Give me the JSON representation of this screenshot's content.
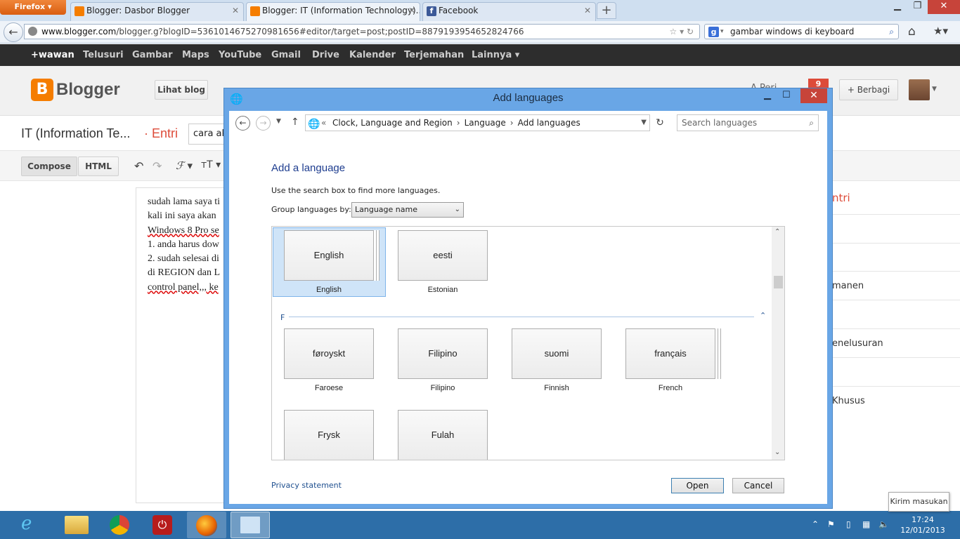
{
  "browser": {
    "firefox_label": "Firefox",
    "tabs": [
      {
        "title": "Blogger: Dasbor Blogger"
      },
      {
        "title": "Blogger: IT (Information Technology)..."
      },
      {
        "title": "Facebook"
      }
    ],
    "new_tab": "+",
    "url_host": "www.blogger.com",
    "url_path": "/blogger.g?blogID=5361014675270981656#editor/target=post;postID=8879193954652824766",
    "search_query": "gambar windows di keyboard"
  },
  "gbar": {
    "items": [
      "+wawan",
      "Telusuri",
      "Gambar",
      "Maps",
      "YouTube",
      "Gmail",
      "Drive",
      "Kalender",
      "Terjemahan",
      "Lainnya ▾"
    ]
  },
  "blogger": {
    "logo_text": "Blogger",
    "view_blog": "Lihat blog",
    "share": "Berbagi",
    "notif_count": "9",
    "post_blog": "IT (Information Te...",
    "post_entri": "· Entri",
    "title_value": "cara ak",
    "compose": "Compose",
    "html": "HTML",
    "editor_lines": [
      "sudah lama saya ti",
      "kali ini saya akan ",
      "Windows 8 Pro se",
      "1. anda harus dow",
      "2. sudah selesai di",
      "di REGION dan L",
      "control panel,,, ke"
    ],
    "side_items": [
      "ntri",
      "manen",
      "enelusuran",
      "Khusus"
    ],
    "partial_right": "A   Peri"
  },
  "dialog": {
    "title": "Add languages",
    "address": {
      "prefix": "«",
      "crumbs": [
        "Clock, Language and Region",
        "Language",
        "Add languages"
      ]
    },
    "search_placeholder": "Search languages",
    "heading": "Add a language",
    "hint": "Use the search box to find more languages.",
    "group_label": "Group languages by:",
    "group_value": "Language name",
    "section_f": "F",
    "languages": [
      {
        "native": "English",
        "name": "English"
      },
      {
        "native": "eesti",
        "name": "Estonian"
      },
      {
        "native": "føroyskt",
        "name": "Faroese"
      },
      {
        "native": "Filipino",
        "name": "Filipino"
      },
      {
        "native": "suomi",
        "name": "Finnish"
      },
      {
        "native": "français",
        "name": "French"
      },
      {
        "native": "Frysk",
        "name": ""
      },
      {
        "native": "Fulah",
        "name": ""
      }
    ],
    "privacy": "Privacy statement",
    "open": "Open",
    "cancel": "Cancel"
  },
  "taskbar": {
    "tooltip": "Kirim masukan",
    "time": "17:24",
    "date": "12/01/2013"
  }
}
